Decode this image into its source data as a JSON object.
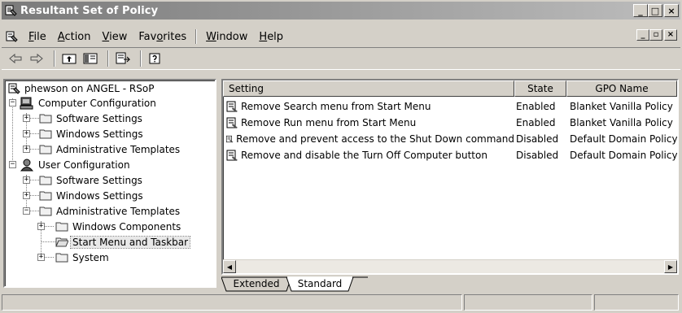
{
  "window": {
    "title": "Resultant Set of Policy",
    "controls": [
      "_",
      "□",
      "×"
    ]
  },
  "menu": {
    "items": [
      "File",
      "Action",
      "View",
      "Favorites",
      "Window",
      "Help"
    ],
    "accel": [
      "F",
      "A",
      "V",
      "o",
      "W",
      "H"
    ],
    "mdi_controls": [
      "_",
      "▫",
      "×"
    ]
  },
  "toolbar": {
    "buttons": [
      "back-icon",
      "forward-icon",
      "up-folder-icon",
      "show-hide-tree-icon",
      "export-list-icon",
      "help-icon"
    ]
  },
  "tree": {
    "root": "phewson on ANGEL - RSoP",
    "computer": "Computer Configuration",
    "comp_software": "Software Settings",
    "comp_windows": "Windows Settings",
    "comp_admin": "Administrative Templates",
    "user": "User Configuration",
    "user_software": "Software Settings",
    "user_windows": "Windows Settings",
    "user_admin": "Administrative Templates",
    "win_components": "Windows Components",
    "start_menu": "Start Menu and Taskbar",
    "system": "System"
  },
  "list": {
    "columns": [
      "Setting",
      "State",
      "GPO Name"
    ],
    "rows": [
      {
        "setting": "Remove Search menu from Start Menu",
        "state": "Enabled",
        "gpo": "Blanket Vanilla Policy"
      },
      {
        "setting": "Remove Run menu from Start Menu",
        "state": "Enabled",
        "gpo": "Blanket Vanilla Policy"
      },
      {
        "setting": "Remove and prevent access to the Shut Down command",
        "state": "Disabled",
        "gpo": "Default Domain Policy"
      },
      {
        "setting": "Remove and disable the Turn Off Computer button",
        "state": "Disabled",
        "gpo": "Default Domain Policy"
      }
    ]
  },
  "tabs": {
    "extended": "Extended",
    "standard": "Standard",
    "active": "Standard"
  },
  "status": {
    "panel1": "",
    "panel2": "",
    "panel3": ""
  }
}
